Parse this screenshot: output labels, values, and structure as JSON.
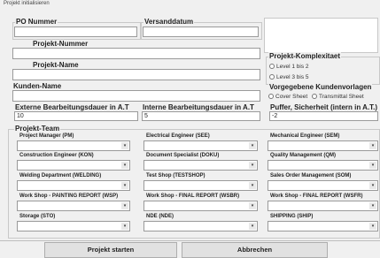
{
  "window": {
    "title": "Projekt initialisieren"
  },
  "fields": {
    "po_nummer": {
      "label": "PO Nummer",
      "value": ""
    },
    "versanddatum": {
      "label": "Versanddatum",
      "value": ""
    },
    "projekt_nummer": {
      "label": "Projekt-Nummer",
      "value": ""
    },
    "projekt_name": {
      "label": "Projekt-Name",
      "value": ""
    },
    "kunden_name": {
      "label": "Kunden-Name",
      "value": ""
    },
    "ext_dauer": {
      "label": "Externe Bearbeitungsdauer in A.T",
      "value": "10"
    },
    "int_dauer": {
      "label": "Interne Bearbeitungsdauer in A.T",
      "value": "5"
    },
    "puffer": {
      "label": "Puffer, Sicherheit (intern in A.T.)",
      "value": "-2"
    }
  },
  "komplexitaet": {
    "label": "Projekt-Komplexitaet",
    "options": [
      "Level 1 bis 2",
      "Level 3 bis 5"
    ]
  },
  "vorlagen": {
    "label": "Vorgegebene Kundenvorlagen",
    "options": [
      "Cover Sheet",
      "Transmittal Sheet"
    ]
  },
  "team": {
    "label": "Projekt-Team",
    "roles": [
      "Project Manager (PM)",
      "Electrical Engineer (SEE)",
      "Mechanical Engineer (SEM)",
      "Construction Engineer (KON)",
      "Document Specialist (DOKU)",
      "Quality Management (QM)",
      "Welding Department (WELDING)",
      "Test Shop (TESTSHOP)",
      "Sales Order Management (SOM)",
      "Work Shop - PAINTING REPORT (WSP)",
      "Work Shop - FINAL REPORT (WSBR)",
      "Work Shop - FINAL REPORT (WSFR)",
      "Storage (STO)",
      "NDE (NDE)",
      "SHIPPING (SHIP)"
    ]
  },
  "buttons": {
    "start": "Projekt starten",
    "cancel": "Abbrechen"
  }
}
